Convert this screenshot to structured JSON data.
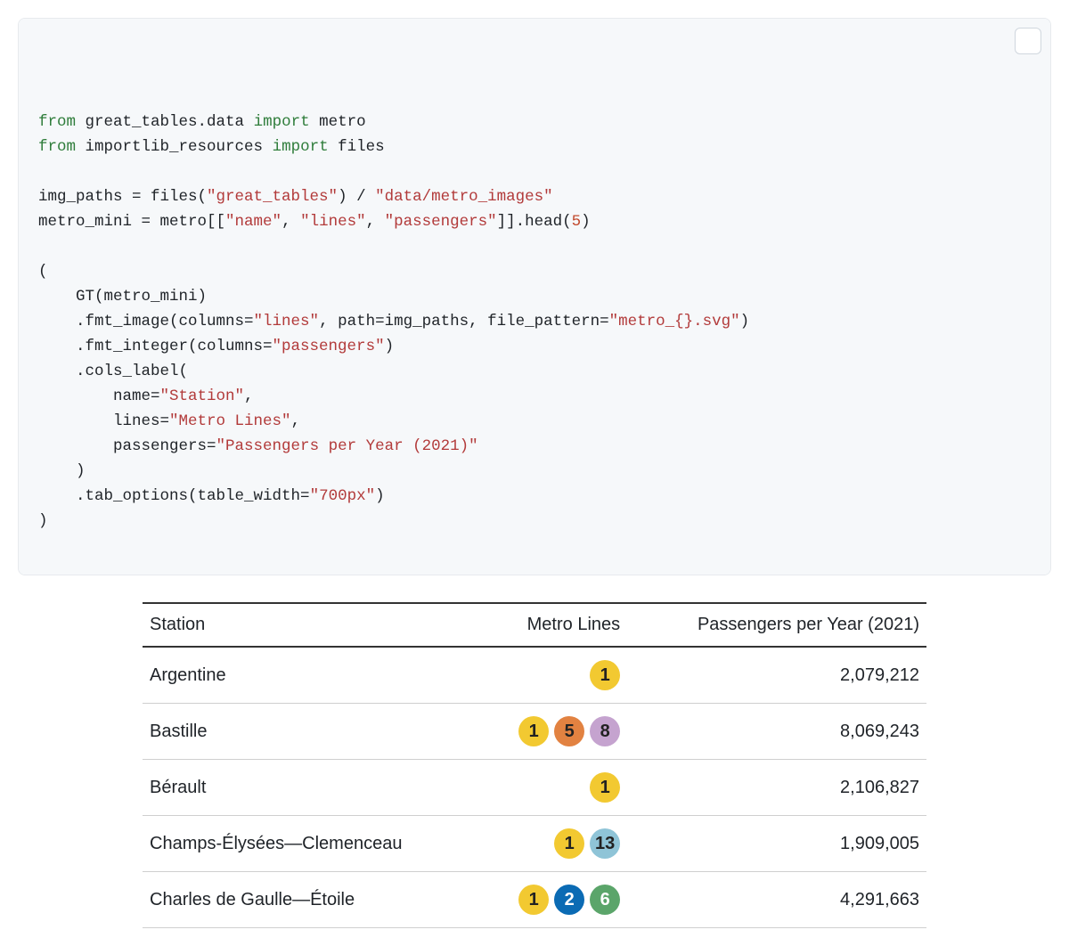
{
  "code": {
    "tokens": [
      [
        [
          "kw",
          "from"
        ],
        [
          "pln",
          " great_tables.data "
        ],
        [
          "kw",
          "import"
        ],
        [
          "pln",
          " metro"
        ]
      ],
      [
        [
          "kw",
          "from"
        ],
        [
          "pln",
          " importlib_resources "
        ],
        [
          "kw",
          "import"
        ],
        [
          "pln",
          " files"
        ]
      ],
      [],
      [
        [
          "pln",
          "img_paths = files("
        ],
        [
          "str",
          "\"great_tables\""
        ],
        [
          "pln",
          ") / "
        ],
        [
          "str",
          "\"data/metro_images\""
        ]
      ],
      [
        [
          "pln",
          "metro_mini = metro[["
        ],
        [
          "str",
          "\"name\""
        ],
        [
          "pln",
          ", "
        ],
        [
          "str",
          "\"lines\""
        ],
        [
          "pln",
          ", "
        ],
        [
          "str",
          "\"passengers\""
        ],
        [
          "pln",
          "]].head("
        ],
        [
          "num",
          "5"
        ],
        [
          "pln",
          ")"
        ]
      ],
      [],
      [
        [
          "pln",
          "("
        ]
      ],
      [
        [
          "pln",
          "    GT(metro_mini)"
        ]
      ],
      [
        [
          "pln",
          "    .fmt_image(columns="
        ],
        [
          "str",
          "\"lines\""
        ],
        [
          "pln",
          ", path=img_paths, file_pattern="
        ],
        [
          "str",
          "\"metro_{}.svg\""
        ],
        [
          "pln",
          ")"
        ]
      ],
      [
        [
          "pln",
          "    .fmt_integer(columns="
        ],
        [
          "str",
          "\"passengers\""
        ],
        [
          "pln",
          ")"
        ]
      ],
      [
        [
          "pln",
          "    .cols_label("
        ]
      ],
      [
        [
          "pln",
          "        name="
        ],
        [
          "str",
          "\"Station\""
        ],
        [
          "pln",
          ","
        ]
      ],
      [
        [
          "pln",
          "        lines="
        ],
        [
          "str",
          "\"Metro Lines\""
        ],
        [
          "pln",
          ","
        ]
      ],
      [
        [
          "pln",
          "        passengers="
        ],
        [
          "str",
          "\"Passengers per Year (2021)\""
        ]
      ],
      [
        [
          "pln",
          "    )"
        ]
      ],
      [
        [
          "pln",
          "    .tab_options(table_width="
        ],
        [
          "str",
          "\"700px\""
        ],
        [
          "pln",
          ")"
        ]
      ],
      [
        [
          "pln",
          ")"
        ]
      ]
    ]
  },
  "table": {
    "headers": {
      "station": "Station",
      "lines": "Metro Lines",
      "passengers": "Passengers per Year (2021)"
    },
    "rows": [
      {
        "station": "Argentine",
        "lines": [
          "1"
        ],
        "passengers": "2,079,212"
      },
      {
        "station": "Bastille",
        "lines": [
          "1",
          "5",
          "8"
        ],
        "passengers": "8,069,243"
      },
      {
        "station": "Bérault",
        "lines": [
          "1"
        ],
        "passengers": "2,106,827"
      },
      {
        "station": "Champs-Élysées—Clemenceau",
        "lines": [
          "1",
          "13"
        ],
        "passengers": "1,909,005"
      },
      {
        "station": "Charles de Gaulle—Étoile",
        "lines": [
          "1",
          "2",
          "6"
        ],
        "passengers": "4,291,663"
      }
    ]
  },
  "metro_line_styles": {
    "1": {
      "bg": "#F2C931",
      "fg": "#222"
    },
    "2": {
      "bg": "#0B6BB4",
      "fg": "#fff"
    },
    "5": {
      "bg": "#E28241",
      "fg": "#222"
    },
    "6": {
      "bg": "#5BA56A",
      "fg": "#fff"
    },
    "8": {
      "bg": "#C5A3CF",
      "fg": "#222"
    },
    "13": {
      "bg": "#8FC4D7",
      "fg": "#222"
    }
  }
}
